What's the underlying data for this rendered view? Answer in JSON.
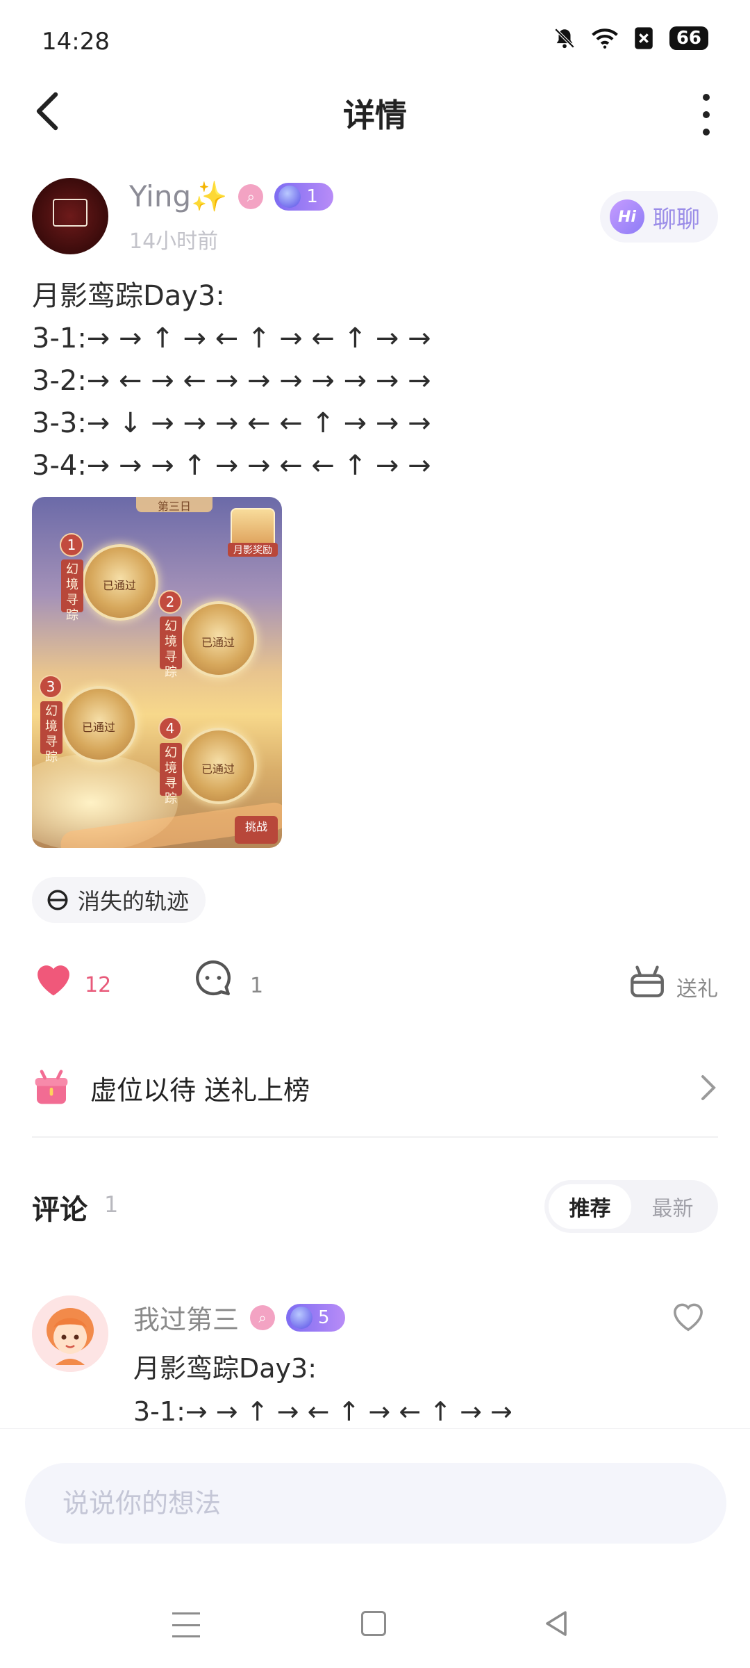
{
  "status_bar": {
    "time": "14:28",
    "battery": "66",
    "icons": [
      "mute-bell-icon",
      "wifi-icon",
      "notification-x-icon",
      "battery-icon"
    ]
  },
  "nav": {
    "title": "详情",
    "back_icon": "chevron-left-icon",
    "more_icon": "more-vertical-icon"
  },
  "post": {
    "author": {
      "name": "Ying✨",
      "level": "1",
      "time": "14小时前"
    },
    "chat_button": {
      "badge": "Hi",
      "label": "聊聊"
    },
    "text": "月影鸾踪Day3:\n3-1:→ → ↑ → ← ↑ → ← ↑ → →\n3-2:→ ← → ← → → → → → → →\n3-3:→ ↓ → → → ← ← ↑ → → →\n3-4:→ → → ↑ → → ← ← ↑ → →",
    "image": {
      "header": "第三日",
      "gift_label": "月影奖励",
      "challenge": "挑战",
      "stages": [
        {
          "num": "1",
          "tag": "幻境寻踪",
          "status": "已通过"
        },
        {
          "num": "2",
          "tag": "幻境寻踪",
          "status": "已通过"
        },
        {
          "num": "3",
          "tag": "幻境寻踪",
          "status": "已通过"
        },
        {
          "num": "4",
          "tag": "幻境寻踪",
          "status": "已通过"
        }
      ]
    },
    "topic": "消失的轨迹",
    "actions": {
      "likes": "12",
      "comments": "1",
      "gift_label": "送礼"
    }
  },
  "gift_rank": {
    "label": "虚位以待 送礼上榜"
  },
  "comments_section": {
    "title": "评论",
    "count": "1",
    "sort_options": [
      "推荐",
      "最新"
    ],
    "active_sort": "推荐",
    "items": [
      {
        "name": "我过第三",
        "level": "5",
        "text": "月影鸾踪Day3:\n3-1:→ → ↑ → ← ↑ → ← ↑ → →"
      }
    ]
  },
  "input": {
    "placeholder": "说说你的想法"
  },
  "colors": {
    "accent_purple": "#8d7cf6",
    "like_red": "#f0587a",
    "text_dark": "#2d2d2d",
    "muted": "#8c8c96"
  }
}
